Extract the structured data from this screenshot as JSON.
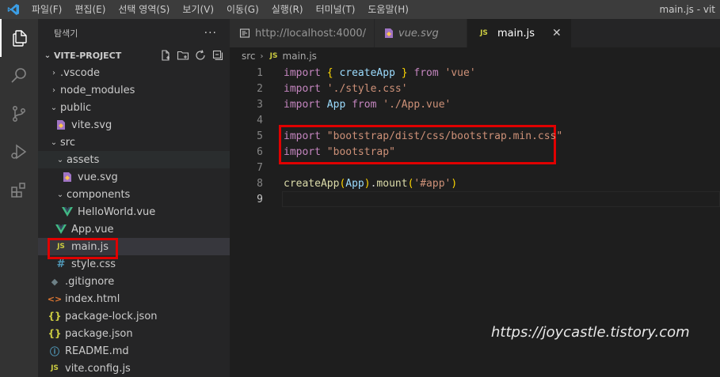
{
  "titlebar": {
    "menus": [
      "파일(F)",
      "편집(E)",
      "선택 영역(S)",
      "보기(V)",
      "이동(G)",
      "실행(R)",
      "터미널(T)",
      "도움말(H)"
    ],
    "window_title": "main.js - vit"
  },
  "sidebar": {
    "title": "탐색기",
    "more": "···",
    "project": "VITE-PROJECT",
    "tree": [
      {
        "label": ".vscode",
        "kind": "folder",
        "expanded": false,
        "depth": 0
      },
      {
        "label": "node_modules",
        "kind": "folder",
        "expanded": false,
        "depth": 0
      },
      {
        "label": "public",
        "kind": "folder",
        "expanded": true,
        "depth": 0
      },
      {
        "label": "vite.svg",
        "kind": "svg",
        "depth": 1
      },
      {
        "label": "src",
        "kind": "folder",
        "expanded": true,
        "depth": 0
      },
      {
        "label": "assets",
        "kind": "folder",
        "expanded": true,
        "depth": 1
      },
      {
        "label": "vue.svg",
        "kind": "svg",
        "depth": 2
      },
      {
        "label": "components",
        "kind": "folder",
        "expanded": true,
        "depth": 1
      },
      {
        "label": "HelloWorld.vue",
        "kind": "vue",
        "depth": 2
      },
      {
        "label": "App.vue",
        "kind": "vue",
        "depth": 1
      },
      {
        "label": "main.js",
        "kind": "js",
        "depth": 1,
        "selected": true
      },
      {
        "label": "style.css",
        "kind": "css",
        "depth": 1
      },
      {
        "label": ".gitignore",
        "kind": "git",
        "depth": 0
      },
      {
        "label": "index.html",
        "kind": "html",
        "depth": 0
      },
      {
        "label": "package-lock.json",
        "kind": "json",
        "depth": 0
      },
      {
        "label": "package.json",
        "kind": "json",
        "depth": 0
      },
      {
        "label": "README.md",
        "kind": "info",
        "depth": 0
      },
      {
        "label": "vite.config.js",
        "kind": "js",
        "depth": 0
      }
    ]
  },
  "tabs": [
    {
      "label": "http://localhost:4000/",
      "icon": "preview-icon",
      "active": false
    },
    {
      "label": "vue.svg",
      "icon": "svg-file-icon",
      "active": false,
      "italic": true
    },
    {
      "label": "main.js",
      "icon": "js-file-icon",
      "active": true,
      "close": "✕"
    }
  ],
  "breadcrumb": {
    "folder": "src",
    "file": "main.js"
  },
  "editor": {
    "current_line": 9,
    "lines": [
      {
        "n": "1",
        "tokens": [
          [
            "kw",
            "import"
          ],
          [
            "punct",
            " "
          ],
          [
            "br1",
            "{"
          ],
          [
            "punct",
            " "
          ],
          [
            "ident",
            "createApp"
          ],
          [
            "punct",
            " "
          ],
          [
            "br1",
            "}"
          ],
          [
            "punct",
            " "
          ],
          [
            "kw",
            "from"
          ],
          [
            "punct",
            " "
          ],
          [
            "str",
            "'vue'"
          ]
        ]
      },
      {
        "n": "2",
        "tokens": [
          [
            "kw",
            "import"
          ],
          [
            "punct",
            " "
          ],
          [
            "str",
            "'./style.css'"
          ]
        ]
      },
      {
        "n": "3",
        "tokens": [
          [
            "kw",
            "import"
          ],
          [
            "punct",
            " "
          ],
          [
            "ident",
            "App"
          ],
          [
            "punct",
            " "
          ],
          [
            "kw",
            "from"
          ],
          [
            "punct",
            " "
          ],
          [
            "str",
            "'./App.vue'"
          ]
        ]
      },
      {
        "n": "4",
        "tokens": []
      },
      {
        "n": "5",
        "tokens": [
          [
            "kw",
            "import"
          ],
          [
            "punct",
            " "
          ],
          [
            "str",
            "\"bootstrap/dist/css/bootstrap.min.css\""
          ]
        ]
      },
      {
        "n": "6",
        "tokens": [
          [
            "kw",
            "import"
          ],
          [
            "punct",
            " "
          ],
          [
            "str",
            "\"bootstrap\""
          ]
        ]
      },
      {
        "n": "7",
        "tokens": []
      },
      {
        "n": "8",
        "tokens": [
          [
            "fn",
            "createApp"
          ],
          [
            "br1",
            "("
          ],
          [
            "ident",
            "App"
          ],
          [
            "br1",
            ")"
          ],
          [
            "punct",
            "."
          ],
          [
            "fn",
            "mount"
          ],
          [
            "br1",
            "("
          ],
          [
            "str",
            "'#app'"
          ],
          [
            "br1",
            ")"
          ]
        ]
      },
      {
        "n": "9",
        "tokens": []
      }
    ]
  },
  "watermark": "https://joycastle.tistory.com",
  "colors": {
    "red_highlight": "#e00000",
    "accent": "#007acc"
  }
}
